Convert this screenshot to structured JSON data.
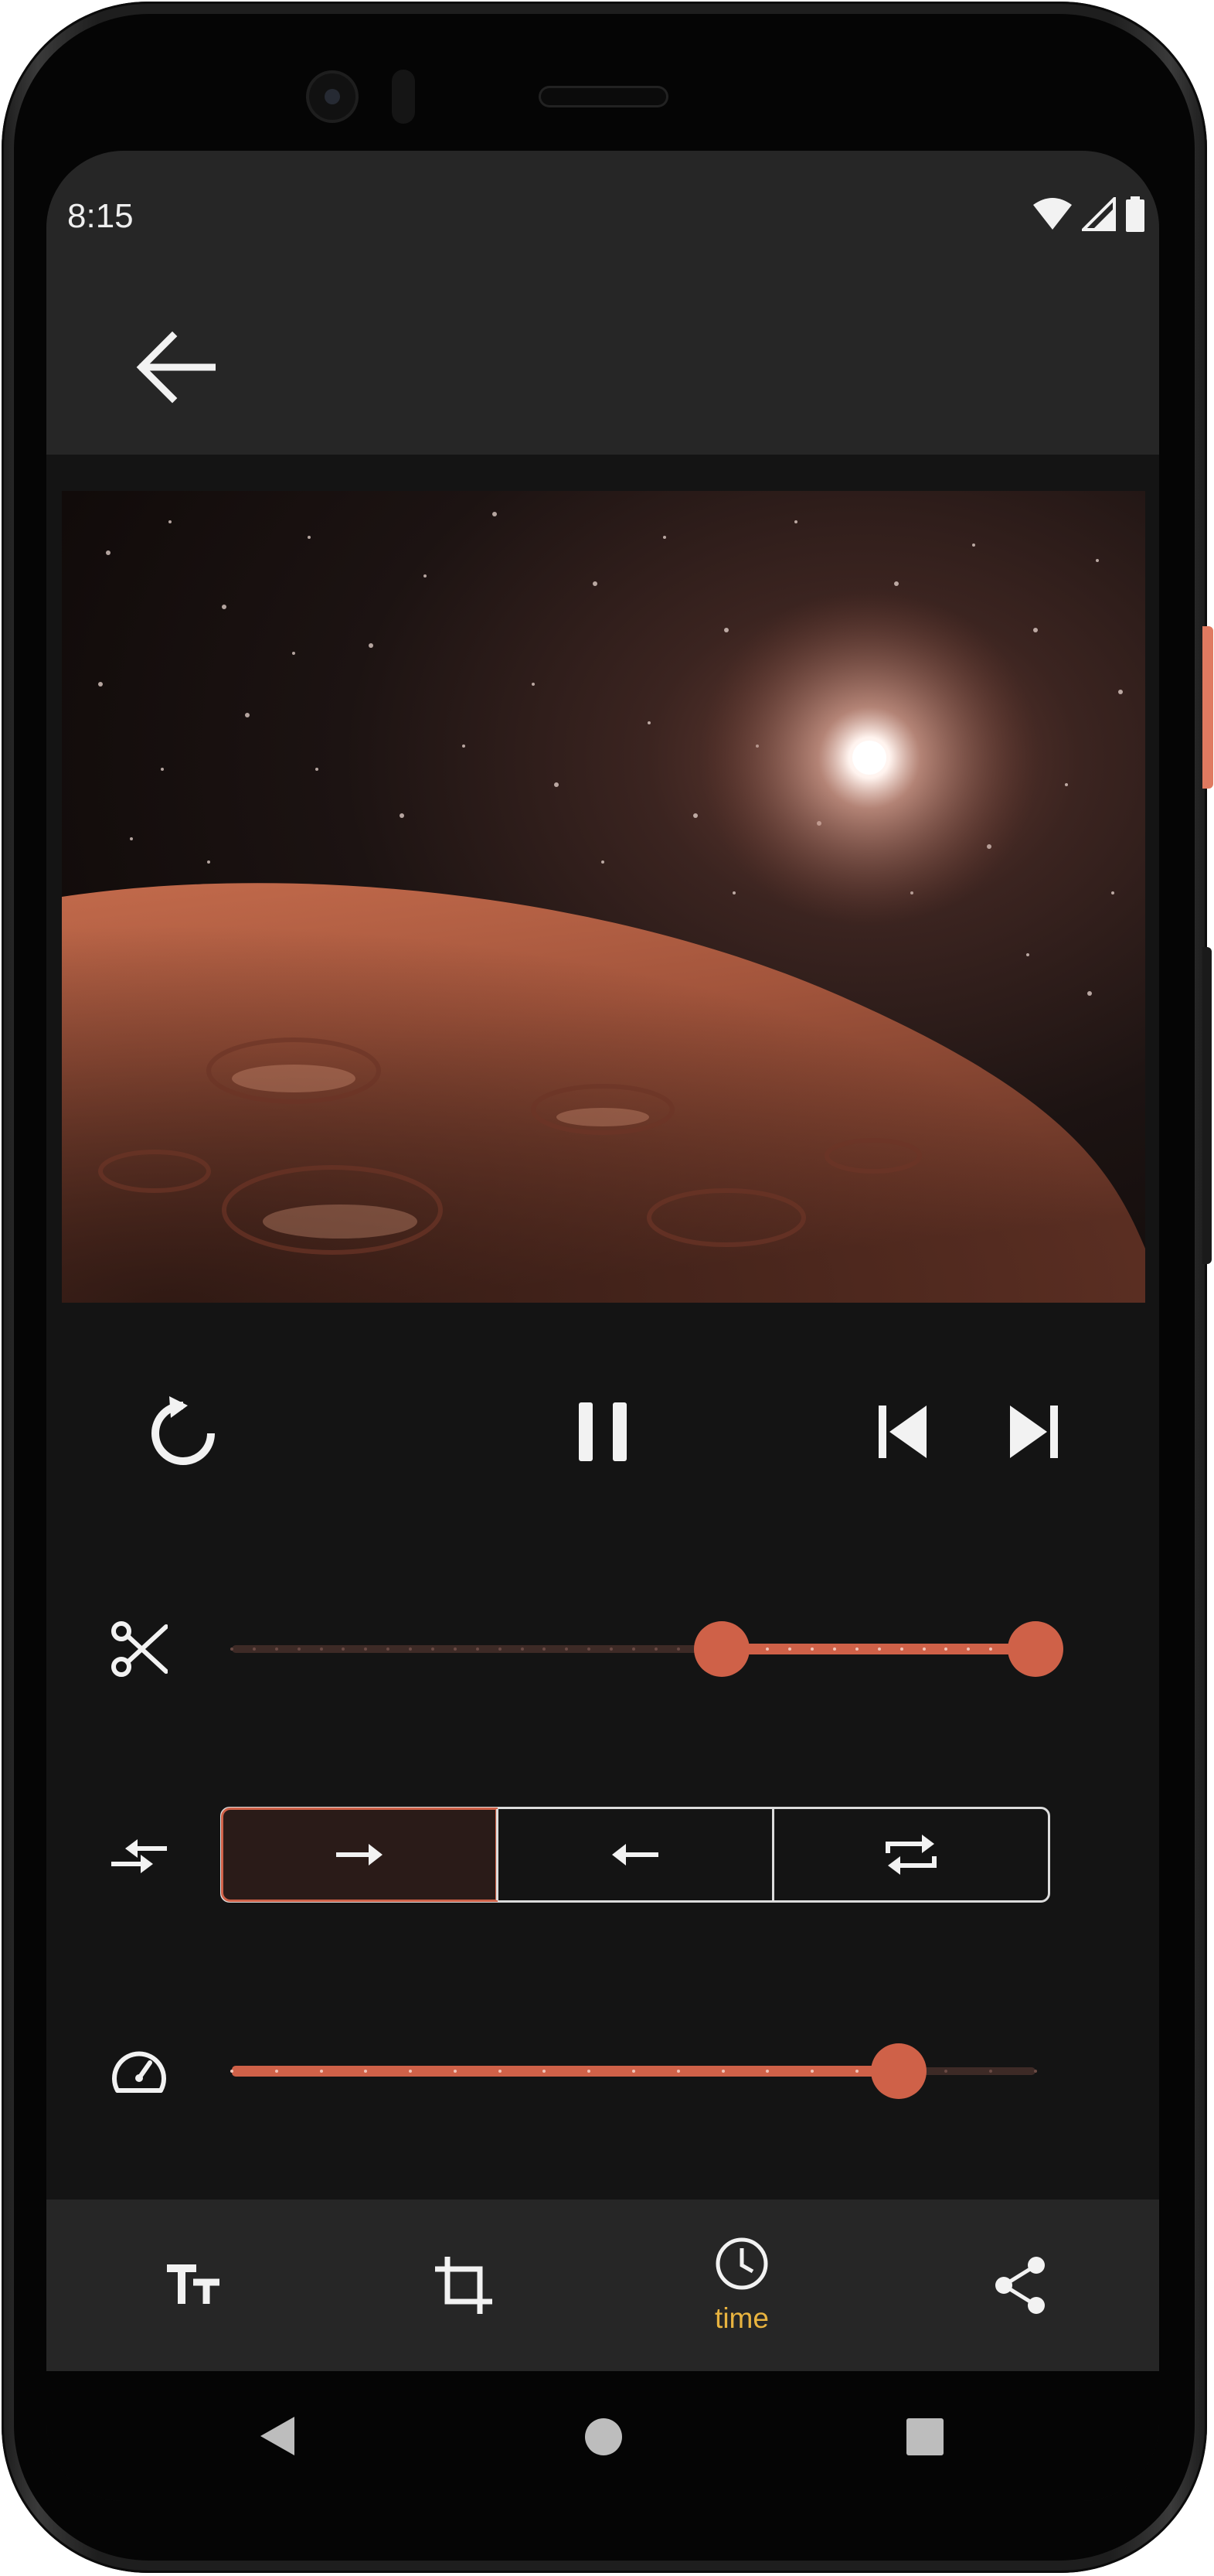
{
  "status_bar": {
    "time": "8:15"
  },
  "app_bar": {
    "back_icon": "arrow-back-icon"
  },
  "video": {
    "description_icon": "video-preview"
  },
  "playback": {
    "replay_icon": "replay-icon",
    "pause_icon": "pause-icon",
    "previous_icon": "skip-previous-icon",
    "next_icon": "skip-next-icon"
  },
  "trim": {
    "icon": "scissors-icon",
    "start": 0.61,
    "end": 1.0
  },
  "direction": {
    "icon": "compare-arrows-icon",
    "options": [
      "forward",
      "backward",
      "loop"
    ],
    "selected": "forward"
  },
  "speed": {
    "icon": "speedometer-icon",
    "value": 0.83
  },
  "bottom_nav": {
    "items": [
      {
        "icon": "text-size-icon",
        "label": ""
      },
      {
        "icon": "crop-icon",
        "label": ""
      },
      {
        "icon": "clock-icon",
        "label": "time"
      },
      {
        "icon": "share-icon",
        "label": ""
      }
    ],
    "active_color": "#E8B33F"
  },
  "colors": {
    "accent": "#CF6148",
    "background": "#141414",
    "bar": "#262626"
  }
}
